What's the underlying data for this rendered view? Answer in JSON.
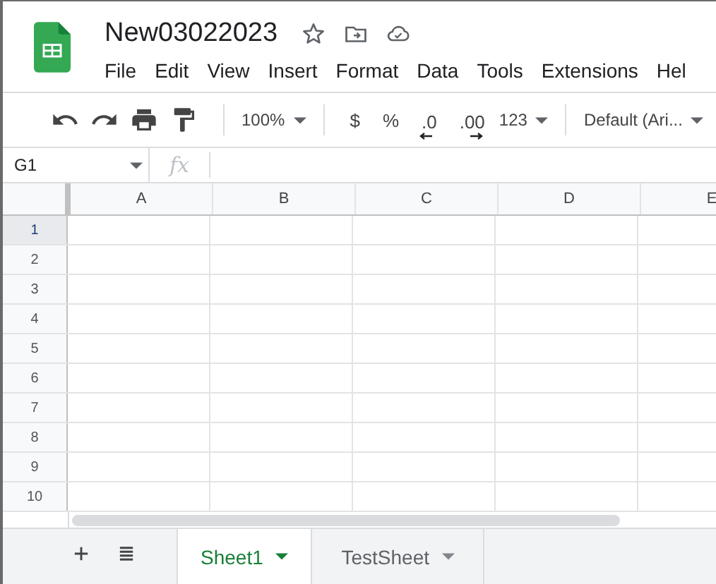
{
  "document": {
    "title": "New03022023"
  },
  "menu": [
    "File",
    "Edit",
    "View",
    "Insert",
    "Format",
    "Data",
    "Tools",
    "Extensions",
    "Hel"
  ],
  "toolbar": {
    "zoom": "100%",
    "currency": "$",
    "percent": "%",
    "decrease_decimals": ".0",
    "increase_decimals": ".00",
    "more_formats": "123",
    "font": "Default (Ari..."
  },
  "formula_bar": {
    "cell": "G1",
    "fx": "fx"
  },
  "columns": [
    "A",
    "B",
    "C",
    "D",
    "E"
  ],
  "rows": [
    {
      "label": "1",
      "selected": true
    },
    {
      "label": "2",
      "selected": false
    },
    {
      "label": "3",
      "selected": false
    },
    {
      "label": "4",
      "selected": false
    },
    {
      "label": "5",
      "selected": false
    },
    {
      "label": "6",
      "selected": false
    },
    {
      "label": "7",
      "selected": false
    },
    {
      "label": "8",
      "selected": false
    },
    {
      "label": "9",
      "selected": false
    },
    {
      "label": "10",
      "selected": false
    }
  ],
  "sheets": [
    {
      "label": "Sheet1",
      "selected": true
    },
    {
      "label": "TestSheet",
      "selected": false
    }
  ]
}
